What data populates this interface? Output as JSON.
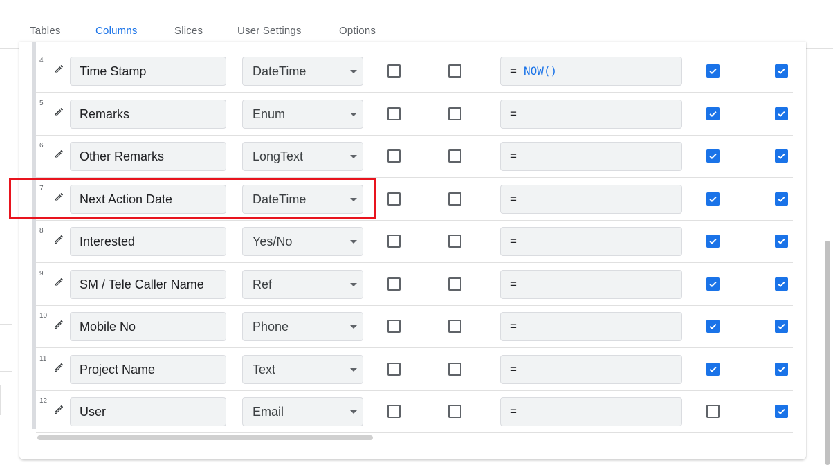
{
  "tabs": [
    {
      "label": "Tables",
      "active": false
    },
    {
      "label": "Columns",
      "active": true
    },
    {
      "label": "Slices",
      "active": false
    },
    {
      "label": "User Settings",
      "active": false
    },
    {
      "label": "Options",
      "active": false
    }
  ],
  "columns": [
    {
      "num": "4",
      "name": "Time Stamp",
      "type": "DateTime",
      "c1": false,
      "c2": false,
      "formula_eq": "=",
      "formula": "NOW()",
      "c3": true,
      "c4": true
    },
    {
      "num": "5",
      "name": "Remarks",
      "type": "Enum",
      "c1": false,
      "c2": false,
      "formula_eq": "=",
      "formula": "",
      "c3": true,
      "c4": true
    },
    {
      "num": "6",
      "name": "Other Remarks",
      "type": "LongText",
      "c1": false,
      "c2": false,
      "formula_eq": "=",
      "formula": "",
      "c3": true,
      "c4": true
    },
    {
      "num": "7",
      "name": "Next Action Date",
      "type": "DateTime",
      "c1": false,
      "c2": false,
      "formula_eq": "=",
      "formula": "",
      "c3": true,
      "c4": true
    },
    {
      "num": "8",
      "name": "Interested",
      "type": "Yes/No",
      "c1": false,
      "c2": false,
      "formula_eq": "=",
      "formula": "",
      "c3": true,
      "c4": true
    },
    {
      "num": "9",
      "name": "SM / Tele Caller Name",
      "type": "Ref",
      "c1": false,
      "c2": false,
      "formula_eq": "=",
      "formula": "",
      "c3": true,
      "c4": true
    },
    {
      "num": "10",
      "name": "Mobile No",
      "type": "Phone",
      "c1": false,
      "c2": false,
      "formula_eq": "=",
      "formula": "",
      "c3": true,
      "c4": true
    },
    {
      "num": "11",
      "name": "Project Name",
      "type": "Text",
      "c1": false,
      "c2": false,
      "formula_eq": "=",
      "formula": "",
      "c3": true,
      "c4": true
    },
    {
      "num": "12",
      "name": "User",
      "type": "Email",
      "c1": false,
      "c2": false,
      "formula_eq": "=",
      "formula": "",
      "c3": false,
      "c4": true
    }
  ],
  "highlighted_row": "7",
  "colors": {
    "accent": "#1a73e8",
    "highlight": "#e8141e",
    "field_bg": "#f1f3f4"
  },
  "icons": {
    "edit": "pencil-icon",
    "dropdown": "caret-down-icon",
    "checkbox_checked": "check-icon"
  }
}
